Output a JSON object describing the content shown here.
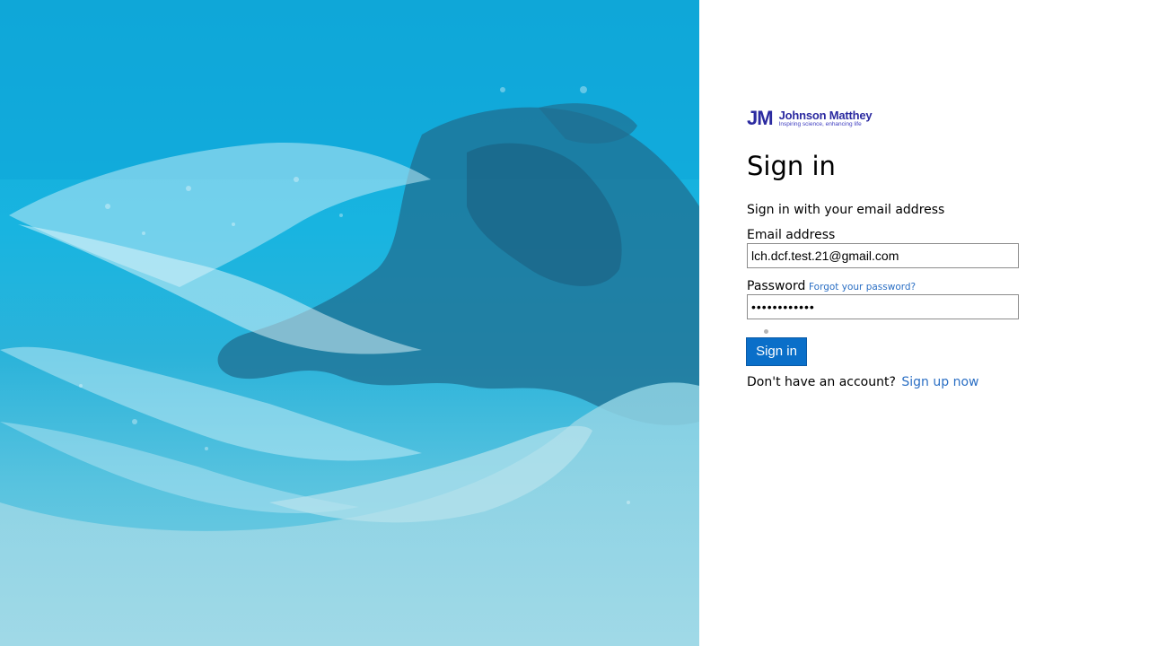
{
  "hero": {
    "description_icon": "ocean-aerial-image"
  },
  "brand": {
    "logo_mark": "JM",
    "logo_name": "Johnson Matthey",
    "logo_tagline": "Inspiring science, enhancing life",
    "color": "#2b2aa0"
  },
  "signin": {
    "title": "Sign in",
    "subtitle": "Sign in with your email address",
    "email_label": "Email address",
    "email_value": "lch.dcf.test.21@gmail.com",
    "password_label": "Password",
    "forgot_link": "Forgot your password?",
    "password_value": "••••••••••••",
    "button_label": "Sign in",
    "no_account_text": "Don't have an account?",
    "signup_link": "Sign up now"
  },
  "colors": {
    "accent": "#0a6fc9",
    "link": "#2b6fc4"
  }
}
